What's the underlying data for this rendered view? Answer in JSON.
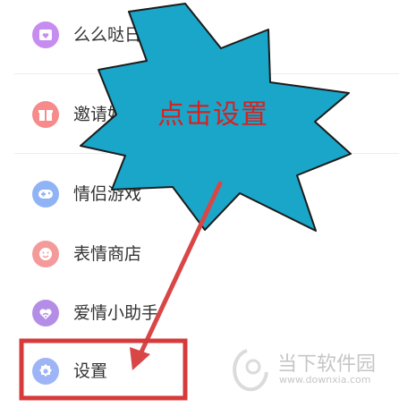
{
  "menu": {
    "items": [
      {
        "label": "么么哒日历",
        "icon": "calendar-heart-icon",
        "color": "#c78cf0"
      },
      {
        "label": "邀请好友",
        "icon": "gift-icon",
        "color": "#f78a8a"
      },
      {
        "label": "情侣游戏",
        "icon": "gamepad-icon",
        "color": "#8fb3f5"
      },
      {
        "label": "表情商店",
        "icon": "emoji-icon",
        "color": "#f59a9a"
      },
      {
        "label": "爱情小助手",
        "icon": "heart-wifi-icon",
        "color": "#b48ee6"
      },
      {
        "label": "设置",
        "icon": "gear-icon",
        "color": "#9db4f7"
      }
    ]
  },
  "annotation": {
    "callout_text": "点击设置",
    "callout_color": "#1aa6c9",
    "arrow_color": "#d94646",
    "highlight_color": "#d63a3a"
  },
  "watermark": {
    "name": "当下软件园",
    "url": "www.downxia.com"
  }
}
